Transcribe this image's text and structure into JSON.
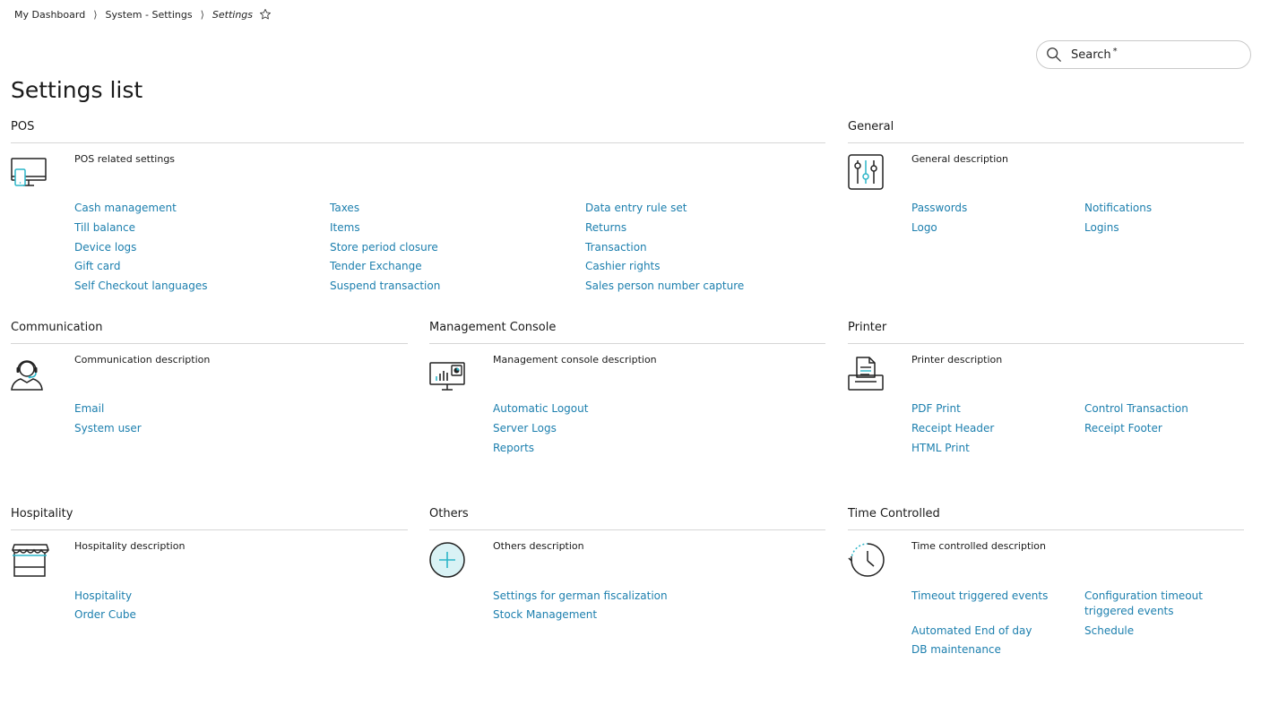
{
  "breadcrumb": {
    "items": [
      "My Dashboard",
      "System - Settings"
    ],
    "current": "Settings",
    "separator": "⟩"
  },
  "search": {
    "label": "Search",
    "required_mark": "*"
  },
  "page_title": "Settings list",
  "colors": {
    "link": "#1c7fae",
    "accent": "#2bb5c8",
    "rule": "#d6d6d6"
  },
  "sections": {
    "pos": {
      "title": "POS",
      "icon": "pos-monitor-icon",
      "description": "POS related settings",
      "links": [
        "Cash management",
        "Till balance",
        "Device logs",
        "Gift card",
        "Self Checkout languages",
        "Taxes",
        "Items",
        "Store period closure",
        "Tender Exchange",
        "Suspend transaction",
        "Data entry rule set",
        "Returns",
        "Transaction",
        "Cashier rights",
        "Sales person number capture"
      ]
    },
    "general": {
      "title": "General",
      "icon": "sliders-icon",
      "description": "General description",
      "links": [
        "Passwords",
        "Logo",
        "Notifications",
        "Logins"
      ]
    },
    "communication": {
      "title": "Communication",
      "icon": "headset-icon",
      "description": "Communication description",
      "links": [
        "Email",
        "System user"
      ]
    },
    "management": {
      "title": "Management Console",
      "icon": "console-monitor-icon",
      "description": "Management console description",
      "links": [
        "Automatic Logout",
        "Server Logs",
        "Reports"
      ]
    },
    "printer": {
      "title": "Printer",
      "icon": "printer-icon",
      "description": "Printer description",
      "links": [
        "PDF Print",
        "Receipt Header",
        "HTML Print",
        "Control Transaction",
        "Receipt Footer"
      ]
    },
    "hospitality": {
      "title": "Hospitality",
      "icon": "storefront-icon",
      "description": "Hospitality description",
      "links": [
        "Hospitality",
        "Order Cube"
      ]
    },
    "others": {
      "title": "Others",
      "icon": "plus-circle-icon",
      "description": "Others description",
      "links": [
        "Settings for german fiscalization",
        "Stock Management"
      ]
    },
    "time": {
      "title": "Time Controlled",
      "icon": "clock-icon",
      "description": "Time controlled description",
      "links": [
        "Timeout triggered events",
        "Automated End of day",
        "DB maintenance",
        "Configuration timeout triggered events",
        "Schedule"
      ]
    }
  }
}
